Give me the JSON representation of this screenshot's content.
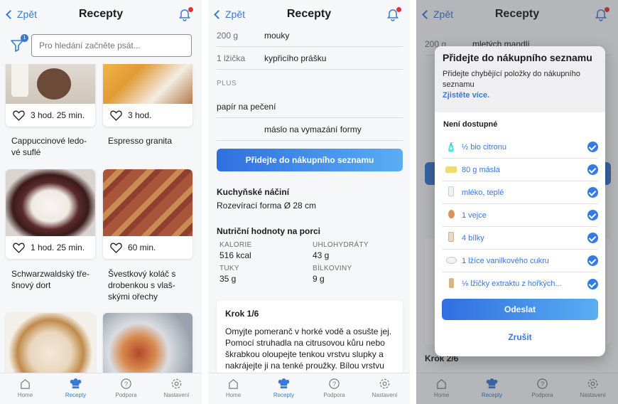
{
  "screens": [
    {
      "nav": {
        "back": "Zpět",
        "title": "Recepty"
      },
      "search": {
        "placeholder": "Pro hledání začněte psát...",
        "filter_count": "1"
      },
      "recipes": [
        {
          "time": "3 hod. 25 min.",
          "title": "Cappuccinové ledo-\nvé suflé"
        },
        {
          "time": "3 hod.",
          "title": "Espresso granita"
        },
        {
          "time": "1 hod. 25 min.",
          "title": "Schwarzwaldský tře-\nšnový dort"
        },
        {
          "time": "60 min.",
          "title": "Švestkový koláč s\ndrobenkou s vlaš-\nskými ořechy"
        }
      ],
      "tabs": [
        "Home",
        "Recepty",
        "Podpora",
        "Nastavení"
      ]
    },
    {
      "nav": {
        "back": "Zpět",
        "title": "Recepty"
      },
      "ingredients": [
        {
          "amount": "200 g",
          "name": "mouky"
        },
        {
          "amount": "1 lžička",
          "name": "kypřicího prášku"
        }
      ],
      "plus_label": "PLUS",
      "plus_items": [
        {
          "amount": "",
          "name": "papír na pečení"
        },
        {
          "amount": "",
          "name": "máslo na vymazání formy"
        }
      ],
      "cta": "Přidejte do nákupního seznamu",
      "equipment": {
        "heading": "Kuchyňské náčiní",
        "text": "Rozevírací forma Ø 28 cm"
      },
      "nutrition": {
        "heading": "Nutriční hodnoty na porci",
        "items": [
          {
            "label": "KALORIE",
            "value": "516 kcal"
          },
          {
            "label": "UHLOHYDRÁTY",
            "value": "43 g"
          },
          {
            "label": "TUKY",
            "value": "35 g"
          },
          {
            "label": "BÍLKOVINY",
            "value": "9 g"
          }
        ]
      },
      "step": {
        "title": "Krok 1/6",
        "text": "Omyjte pomeranč v horké vodě a osušte jej. Pomocí struhadla na citrusovou kůru nebo škrabkou oloupejte tenkou vrstvu slupky a nakrájejte ji na tenké proužky. Bílou vrstvu slupky oloupejte"
      },
      "tabs": [
        "Home",
        "Recepty",
        "Podpora",
        "Nastavení"
      ]
    },
    {
      "nav": {
        "back": "Zpět",
        "title": "Recepty"
      },
      "background": {
        "row1_amount": "200 g",
        "row1_name": "mletých mandlí",
        "krok": "Krok 2/6"
      },
      "modal": {
        "title": "Přidejte do nákupního seznamu",
        "description": "Přidejte chybějící položky do nákupního seznamu",
        "link": "Zjistěte více.",
        "subheading": "Není dostupné",
        "items": [
          {
            "icon": "lemon-icon",
            "label": "½ bio citronu"
          },
          {
            "icon": "butter-icon",
            "label": "80 g másla"
          },
          {
            "icon": "milk-icon",
            "label": "mléko, teplé"
          },
          {
            "icon": "egg-icon",
            "label": "1 vejce"
          },
          {
            "icon": "egg-white-icon",
            "label": "4 bílky"
          },
          {
            "icon": "sugar-icon",
            "label": "1 lžíce vanilkového cukru"
          },
          {
            "icon": "extract-icon",
            "label": "⅛ lžičky extraktu z hořkých..."
          }
        ],
        "send": "Odeslat",
        "cancel": "Zrušit"
      },
      "tabs": [
        "Home",
        "Recepty",
        "Podpora",
        "Nastavení"
      ]
    }
  ],
  "colors": {
    "accent": "#3a78d6",
    "badge": "#e5303a",
    "check": "#2f7be8"
  }
}
